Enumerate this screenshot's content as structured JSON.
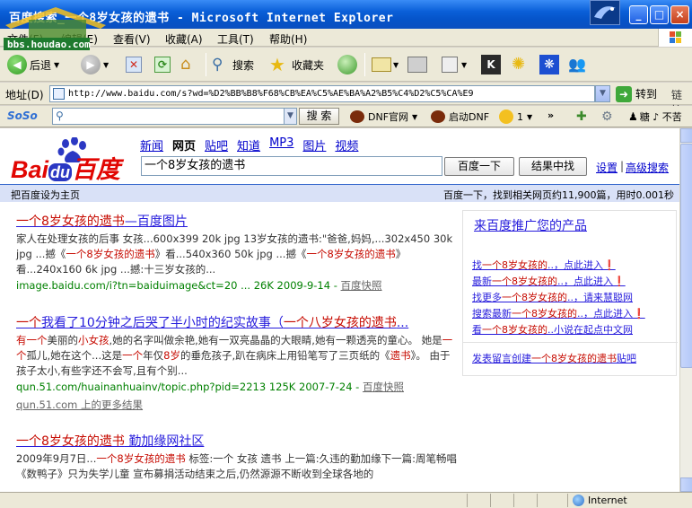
{
  "window": {
    "title": "百度搜索_一个8岁女孩的遗书 - Microsoft Internet Explorer",
    "watermark": "bbs.houdao.com"
  },
  "menu": {
    "items": [
      "文件(F)",
      "编辑(E)",
      "查看(V)",
      "收藏(A)",
      "工具(T)",
      "帮助(H)"
    ]
  },
  "toolbar": {
    "back": "后退",
    "search": "搜索",
    "favorites": "收藏夹"
  },
  "address": {
    "label": "地址(D)",
    "url": "http://www.baidu.com/s?wd=%D2%BB%B8%F68%CB%EA%C5%AE%BA%A2%B5%C4%D2%C5%CA%E9",
    "go": "转到",
    "links": "链接"
  },
  "soso": {
    "brand": "SoSo",
    "search_btn": "搜 索",
    "dnf_official": "DNF官网",
    "start_dnf": "启动DNF",
    "count": "1",
    "extra": "糖 ♪ 不苦"
  },
  "baidu": {
    "logo_left": "Bai",
    "logo_du": "du",
    "logo_right": "百度",
    "nav": [
      "新闻",
      "网页",
      "贴吧",
      "知道",
      "MP3",
      "图片",
      "视频"
    ],
    "query": "一个8岁女孩的遗书",
    "search_btn": "百度一下",
    "within_btn": "结果中找",
    "settings": "设置",
    "advanced": "高级搜索",
    "separator": "|",
    "set_home": "把百度设为主页",
    "result_count": "百度一下，找到相关网页约11,900篇，用时0.001秒"
  },
  "results": [
    {
      "title_html": "<em>一个8岁女孩的遗书</em>—百度图片",
      "abstract_html": "家人在处理女孩的后事 女孩...600x399 20k jpg 13岁女孩的遗书:\"爸爸,妈妈,...302x450 30k jpg ...撼《<em>一个8岁女孩的遗书</em>》看...540x360 50k jpg ...撼《<em>一个8岁女孩的遗书</em>》看...240x160 6k jpg ...撼:十三岁女孩的...",
      "url": "image.baidu.com/i?tn=baiduimage&ct=20 ... 26K 2009-9-14 - ",
      "cache": "百度快照"
    },
    {
      "title_html": "<em>一个</em>我看了10分钟之后哭了半小时的纪实故事（<em>一个八岁女孩的遗书</em>...",
      "abstract_html": "<em>有一个</em>美丽的<em>小女孩</em>,她的名字叫做余艳,她有一双亮晶晶的大眼睛,她有一颗透亮的童心。 她是<em>一个</em>孤儿,她在这个...这是<em>一个</em>年仅<em>8岁</em>的垂危孩子,趴在病床上用铅笔写了三页纸的《<em>遗书</em>》。 由于孩子太小,有些字还不会写,且有个别...",
      "url": "qun.51.com/huainanhuainv/topic.php?pid=2213 125K 2007-7-24 - ",
      "cache": "百度快照",
      "more": "qun.51.com 上的更多结果"
    },
    {
      "title_html": "<em>一个8岁女孩的遗书</em> 勤加缘网社区",
      "abstract_html": "2009年9月7日...<em>一个8岁女孩的遗书</em> 标签:一个 女孩 遗书 上一篇:久违的勤加缘下一篇:周笔畅唱《数鸭子》只为失学儿童 宣布募捐活动结束之后,仍然源源不断收到全球各地的"
    }
  ],
  "ads": {
    "header": "来百度推广您的产品",
    "lines_html": [
      "找<em>一个8岁女孩的</em>..，点此进入❗",
      "最新<em>一个8岁女孩的</em>..，点此进入❗",
      "找更多<em>一个8岁女孩的</em>..，请来慧聪网",
      "搜索最新<em>一个8岁女孩的</em>..，点此进入❗",
      "看<em>一个8岁女孩的</em>..小说在起点中文网"
    ],
    "footer_html": "发表留言创建<em>一个8岁女孩的遗书</em>贴吧"
  },
  "status": {
    "zone": "Internet"
  },
  "colors": {
    "link": "#261cdc",
    "highlight": "#c60a00",
    "url_green": "#008000",
    "xp_blue": "#0553c8"
  }
}
